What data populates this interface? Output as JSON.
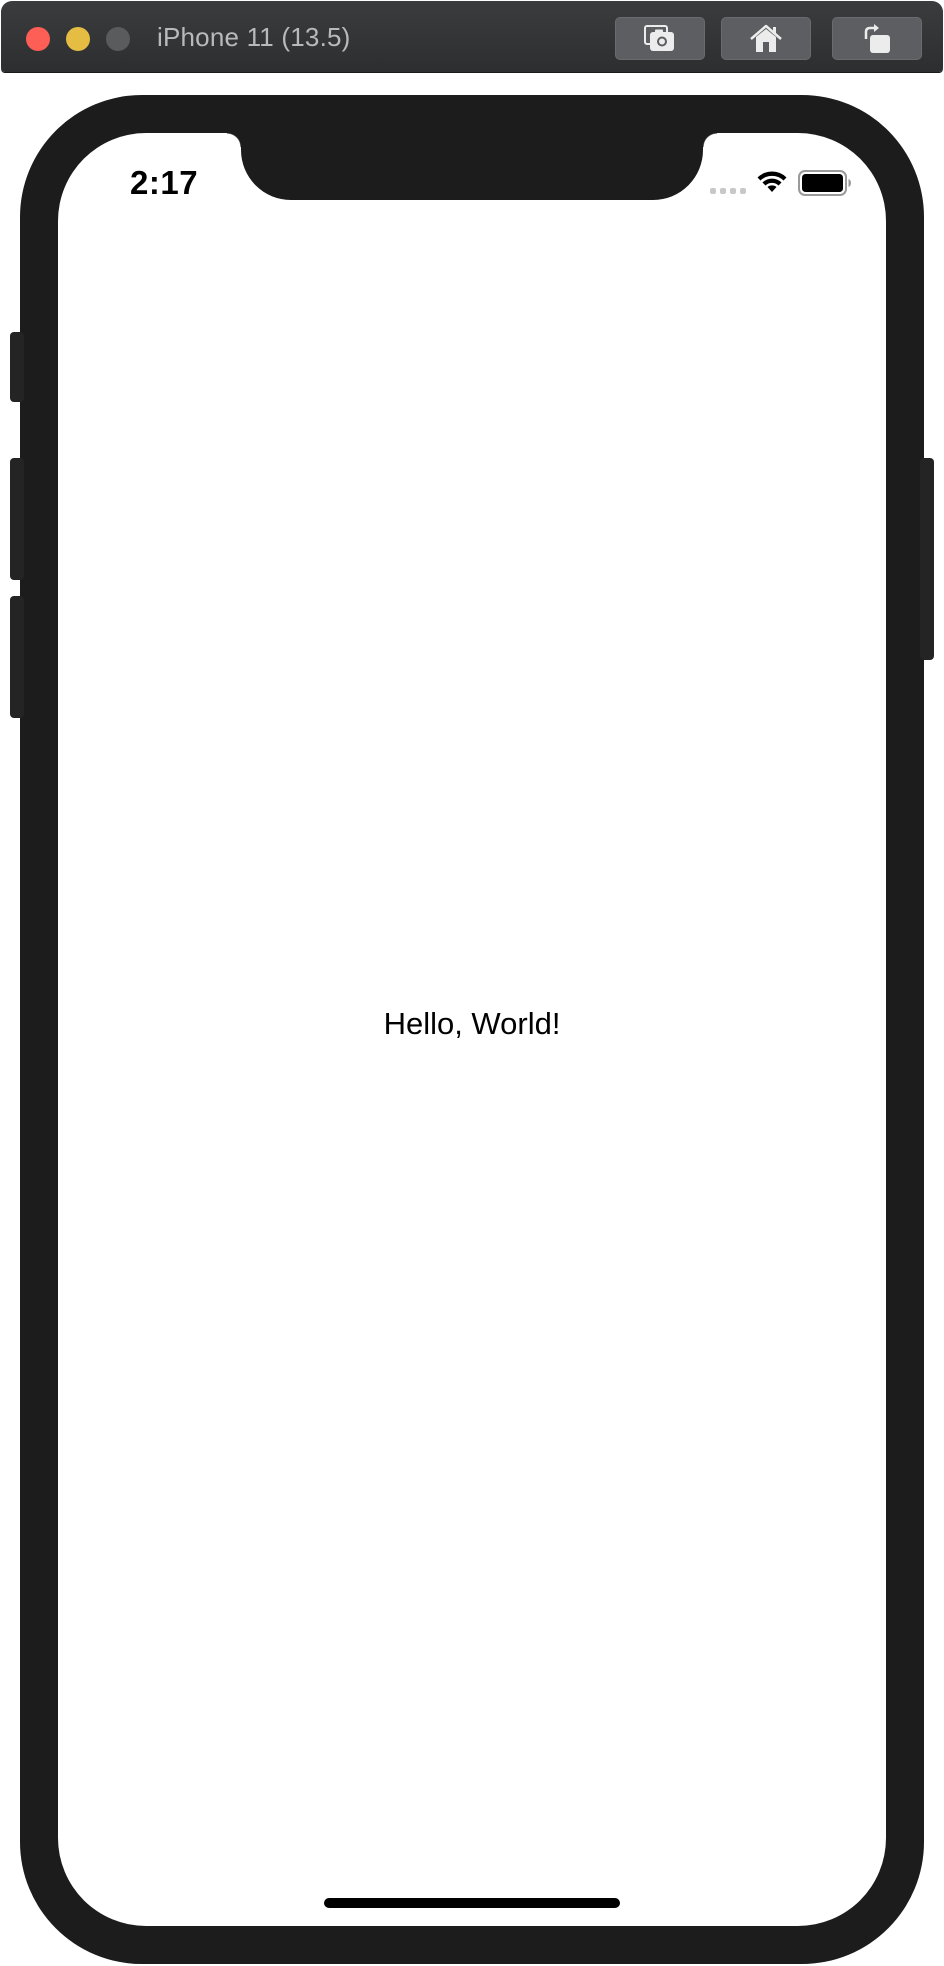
{
  "window": {
    "title": "iPhone 11 (13.5)",
    "traffic_lights": {
      "close_color": "#fd5f57",
      "minimize_color": "#e5bd43",
      "zoom_color": "#5a5b5d"
    },
    "toolbar": {
      "screenshot_icon": "camera-icon",
      "home_icon": "home-icon",
      "rotate_icon": "rotate-icon"
    }
  },
  "status_bar": {
    "time": "2:17",
    "signal_icon": "cellular-signal-icon",
    "wifi_icon": "wifi-icon",
    "battery_icon": "battery-icon"
  },
  "content": {
    "text": "Hello, World!"
  },
  "colors": {
    "device_frame": "#1c1c1c",
    "screen_background": "#ffffff",
    "title_bar": "#333436"
  }
}
